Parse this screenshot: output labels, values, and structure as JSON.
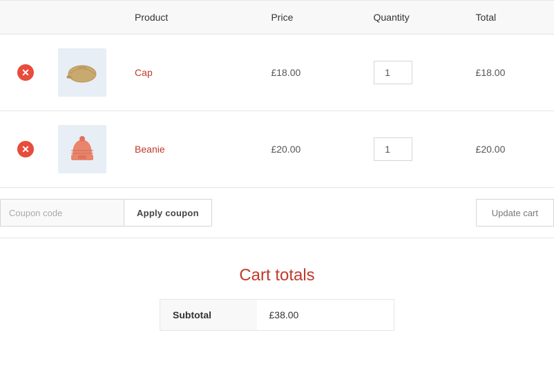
{
  "header": {
    "columns": {
      "product": "Product",
      "price": "Price",
      "quantity": "Quantity",
      "total": "Total"
    }
  },
  "cart": {
    "items": [
      {
        "id": "cap",
        "name": "Cap",
        "price": "£18.00",
        "quantity": 1,
        "total": "£18.00"
      },
      {
        "id": "beanie",
        "name": "Beanie",
        "price": "£20.00",
        "quantity": 1,
        "total": "£20.00"
      }
    ]
  },
  "coupon": {
    "placeholder": "Coupon code",
    "apply_label": "Apply coupon"
  },
  "actions": {
    "update_cart_label": "Update cart"
  },
  "totals": {
    "title": "Cart totals",
    "subtotal_label": "Subtotal",
    "subtotal_value": "£38.00"
  }
}
